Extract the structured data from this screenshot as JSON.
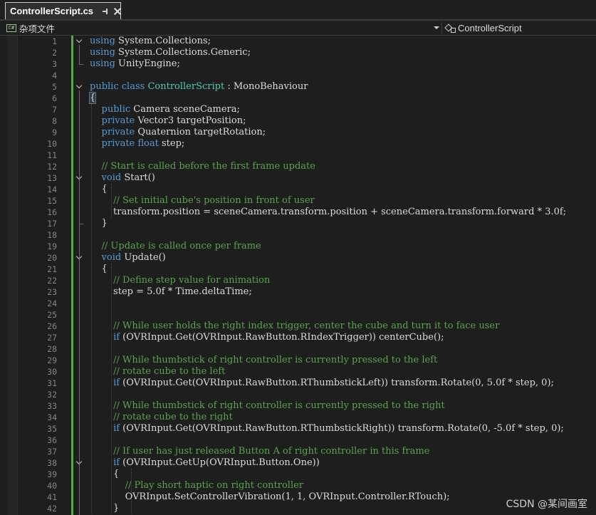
{
  "tab": {
    "title": "ControllerScript.cs"
  },
  "navbar": {
    "left_label": "杂项文件",
    "left_icon_text": "C#",
    "right_label": "ControllerScript"
  },
  "colors": {
    "keyword": "#569cd6",
    "type": "#4ec9b0",
    "comment": "#57a64a",
    "number": "#b5cea8",
    "plain": "#dcdcdc",
    "line_number": "#858585",
    "change_bar": "#57a64a"
  },
  "icons": [
    "csharp-file-icon",
    "dropdown-arrow-icon",
    "class-member-icon",
    "pin-icon",
    "close-icon",
    "fold-chevron-icon"
  ],
  "editor": {
    "lines": [
      [
        {
          "t": "using",
          "c": "kw"
        },
        {
          "t": " System.Collections;"
        }
      ],
      [
        {
          "t": "using",
          "c": "kw"
        },
        {
          "t": " System.Collections.Generic;"
        }
      ],
      [
        {
          "t": "using",
          "c": "kw"
        },
        {
          "t": " UnityEngine;"
        }
      ],
      [],
      [
        {
          "t": "public",
          "c": "kw"
        },
        {
          "t": " "
        },
        {
          "t": "class",
          "c": "kw"
        },
        {
          "t": " "
        },
        {
          "t": "ControllerScript",
          "c": "ty"
        },
        {
          "t": " : MonoBehaviour"
        }
      ],
      [
        {
          "t": "{",
          "c": "bracehl"
        }
      ],
      [
        {
          "t": "    "
        },
        {
          "t": "public",
          "c": "kw"
        },
        {
          "t": " Camera sceneCamera;"
        }
      ],
      [
        {
          "t": "    "
        },
        {
          "t": "private",
          "c": "kw"
        },
        {
          "t": " Vector3 targetPosition;"
        }
      ],
      [
        {
          "t": "    "
        },
        {
          "t": "private",
          "c": "kw"
        },
        {
          "t": " Quaternion targetRotation;"
        }
      ],
      [
        {
          "t": "    "
        },
        {
          "t": "private",
          "c": "kw"
        },
        {
          "t": " "
        },
        {
          "t": "float",
          "c": "kw"
        },
        {
          "t": " step;"
        }
      ],
      [],
      [
        {
          "t": "    "
        },
        {
          "t": "// Start is called before the first frame update",
          "c": "cm"
        }
      ],
      [
        {
          "t": "    "
        },
        {
          "t": "void",
          "c": "kw"
        },
        {
          "t": " Start()"
        }
      ],
      [
        {
          "t": "    {"
        }
      ],
      [
        {
          "t": "        "
        },
        {
          "t": "// Set initial cube's position in front of user",
          "c": "cm"
        }
      ],
      [
        {
          "t": "        transform.position = sceneCamera.transform.position + sceneCamera.transform.forward * 3.0f;"
        }
      ],
      [
        {
          "t": "    }"
        }
      ],
      [],
      [
        {
          "t": "    "
        },
        {
          "t": "// Update is called once per frame",
          "c": "cm"
        }
      ],
      [
        {
          "t": "    "
        },
        {
          "t": "void",
          "c": "kw"
        },
        {
          "t": " Update()"
        }
      ],
      [
        {
          "t": "    {"
        }
      ],
      [
        {
          "t": "        "
        },
        {
          "t": "// Define step value for animation",
          "c": "cm"
        }
      ],
      [
        {
          "t": "        step = 5.0f * Time.deltaTime;"
        }
      ],
      [],
      [],
      [
        {
          "t": "        "
        },
        {
          "t": "// While user holds the right index trigger, center the cube and turn it to face user",
          "c": "cm"
        }
      ],
      [
        {
          "t": "        "
        },
        {
          "t": "if",
          "c": "kw"
        },
        {
          "t": " (OVRInput.Get(OVRInput.RawButton.RIndexTrigger)) centerCube();"
        }
      ],
      [],
      [
        {
          "t": "        "
        },
        {
          "t": "// While thumbstick of right controller is currently pressed to the left",
          "c": "cm"
        }
      ],
      [
        {
          "t": "        "
        },
        {
          "t": "// rotate cube to the left",
          "c": "cm"
        }
      ],
      [
        {
          "t": "        "
        },
        {
          "t": "if",
          "c": "kw"
        },
        {
          "t": " (OVRInput.Get(OVRInput.RawButton.RThumbstickLeft)) transform.Rotate(0, 5.0f * step, 0);"
        }
      ],
      [],
      [
        {
          "t": "        "
        },
        {
          "t": "// While thumbstick of right controller is currently pressed to the right",
          "c": "cm"
        }
      ],
      [
        {
          "t": "        "
        },
        {
          "t": "// rotate cube to the right",
          "c": "cm"
        }
      ],
      [
        {
          "t": "        "
        },
        {
          "t": "if",
          "c": "kw"
        },
        {
          "t": " (OVRInput.Get(OVRInput.RawButton.RThumbstickRight)) transform.Rotate(0, -5.0f * step, 0);"
        }
      ],
      [],
      [
        {
          "t": "        "
        },
        {
          "t": "// If user has just released Button A of right controller in this frame",
          "c": "cm"
        }
      ],
      [
        {
          "t": "        "
        },
        {
          "t": "if",
          "c": "kw"
        },
        {
          "t": " (OVRInput.GetUp(OVRInput.Button.One))"
        }
      ],
      [
        {
          "t": "        {"
        }
      ],
      [
        {
          "t": "            "
        },
        {
          "t": "// Play short haptic on right controller",
          "c": "cm"
        }
      ],
      [
        {
          "t": "            OVRInput.SetControllerVibration(1, 1, OVRInput.Controller.RTouch);"
        }
      ],
      [
        {
          "t": "        }"
        }
      ]
    ]
  },
  "watermark": "CSDN @某间画室"
}
